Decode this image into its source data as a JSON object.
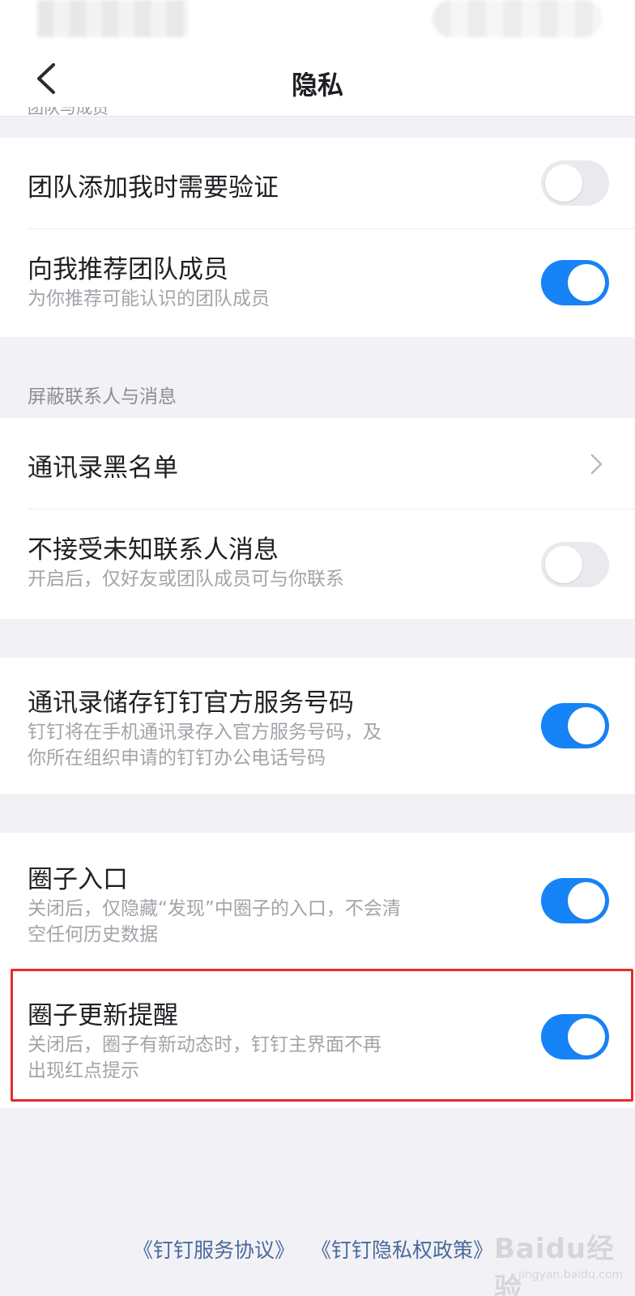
{
  "nav": {
    "title": "隐私"
  },
  "sections": {
    "team_header_cut": "团队与成员",
    "team": {
      "verify_title": "团队添加我时需要验证",
      "recommend_title": "向我推荐团队成员",
      "recommend_sub": "为你推荐可能认识的团队成员"
    },
    "block": {
      "header": "屏蔽联系人与消息",
      "blacklist_title": "通讯录黑名单",
      "unknown_title": "不接受未知联系人消息",
      "unknown_sub": "开启后，仅好友或团队成员可与你联系"
    },
    "contacts": {
      "save_title": "通讯录储存钉钉官方服务号码",
      "save_sub_line1": "钉钉将在手机通讯录存入官方服务号码，及",
      "save_sub_line2": "你所在组织申请的钉钉办公电话号码"
    },
    "circle": {
      "entry_title": "圈子入口",
      "entry_sub_line1": "关闭后，仅隐藏“发现”中圈子的入口，不会清",
      "entry_sub_line2": "空任何历史数据",
      "update_title": "圈子更新提醒",
      "update_sub_line1": "关闭后，圈子有新动态时，钉钉主界面不再",
      "update_sub_line2": "出现红点提示"
    }
  },
  "toggles": {
    "team_verify": false,
    "recommend_members": true,
    "reject_unknown": false,
    "save_service_numbers": true,
    "circle_entry": true,
    "circle_update_reminder": true
  },
  "footer": {
    "service_agreement": "《钉钉服务协议》",
    "privacy_policy": "《钉钉隐私权政策》"
  },
  "watermark": {
    "main": "Baidu经验",
    "sub": "jingyan.baidu.com"
  },
  "colors": {
    "accent": "#1683f6",
    "highlight": "#e52b2b",
    "link": "#4a6a9c"
  },
  "icons": {
    "back": "chevron-left-icon",
    "row_arrow": "chevron-right-icon"
  }
}
